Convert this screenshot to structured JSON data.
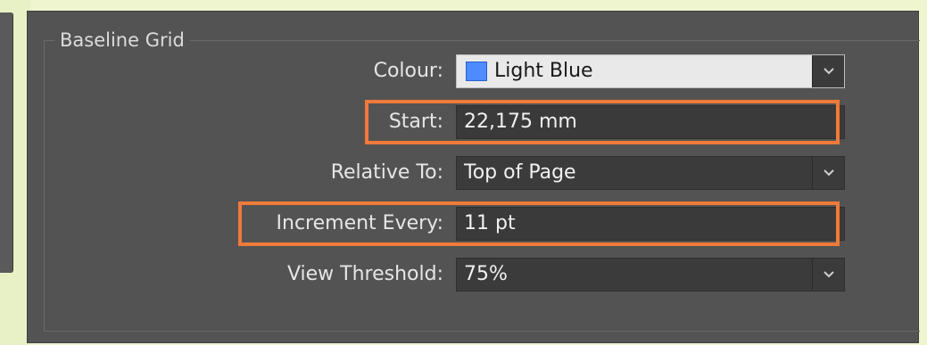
{
  "group": {
    "title": "Baseline Grid"
  },
  "colour": {
    "label": "Colour:",
    "value": "Light Blue",
    "swatch": "#4d8bff"
  },
  "start": {
    "label": "Start:",
    "value": "22,175 mm"
  },
  "relative_to": {
    "label": "Relative To:",
    "value": "Top of Page"
  },
  "increment": {
    "label": "Increment Every:",
    "value": "11 pt"
  },
  "view_threshold": {
    "label": "View Threshold:",
    "value": "75%"
  },
  "highlight_color": "#f07a3a"
}
